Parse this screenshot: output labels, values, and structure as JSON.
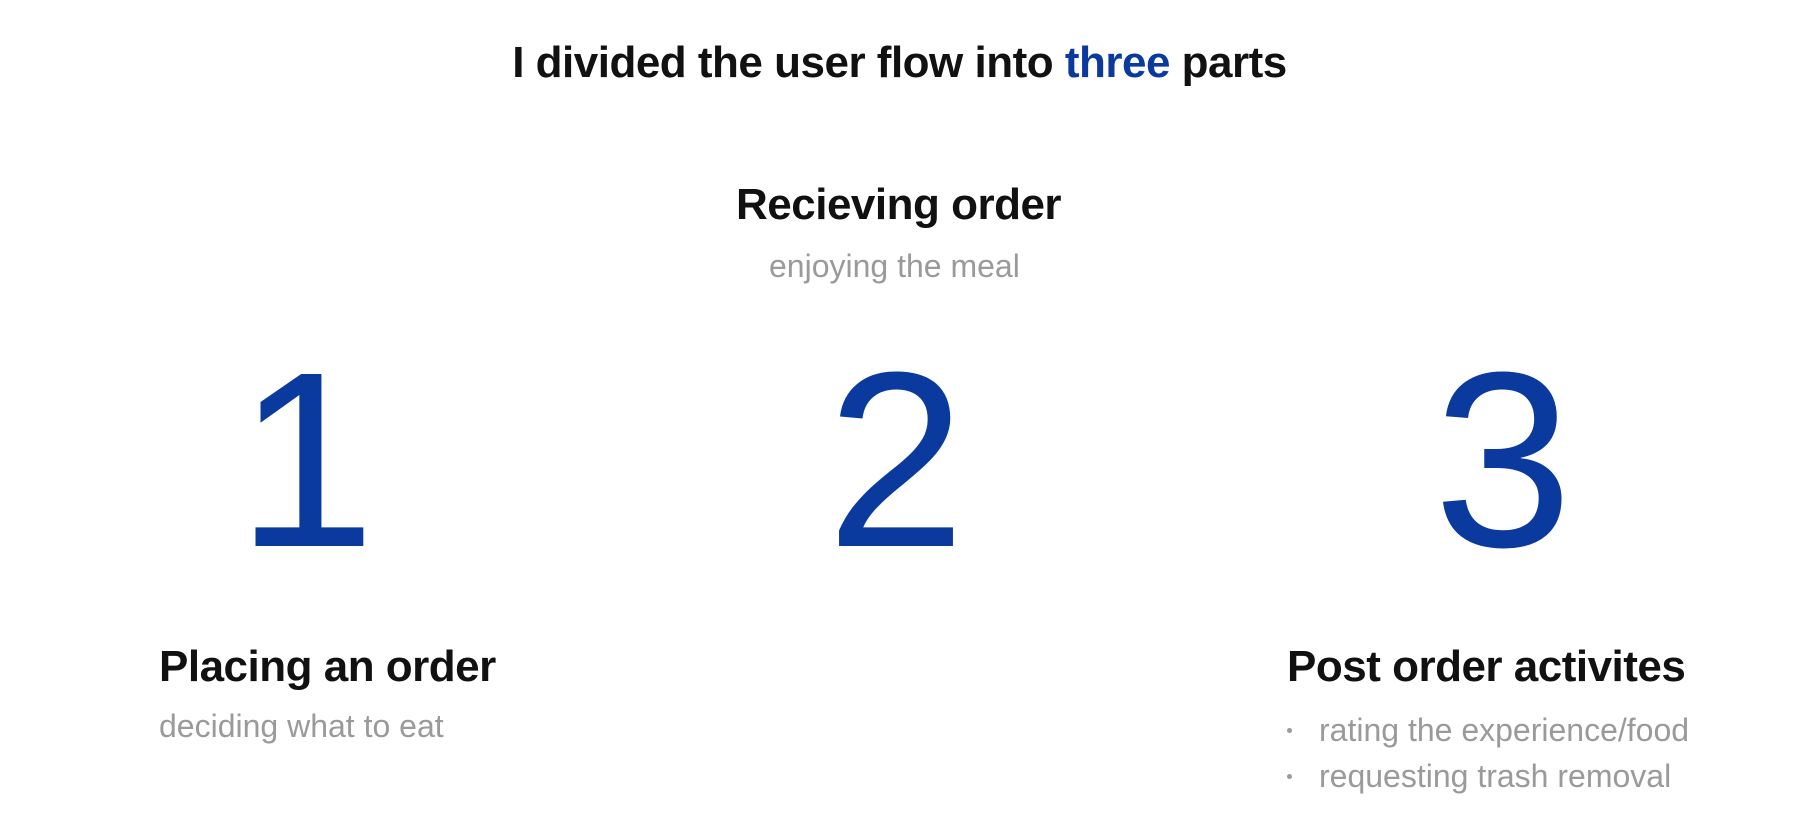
{
  "headline": {
    "before": "I divided the user flow into ",
    "accent": "three",
    "after": " parts",
    "accent_color": "#0b3a9e"
  },
  "steps": [
    {
      "number": "1",
      "title": "Placing an order",
      "subtitle": "deciding what to eat"
    },
    {
      "number": "2",
      "title": "Recieving order",
      "subtitle": "enjoying the meal"
    },
    {
      "number": "3",
      "title": "Post order activites",
      "bullets": [
        "rating the experience/food",
        "requesting trash removal"
      ]
    }
  ],
  "colors": {
    "numeral": "#0b3a9e",
    "title": "#111111",
    "subtitle": "#9a9a9a"
  }
}
